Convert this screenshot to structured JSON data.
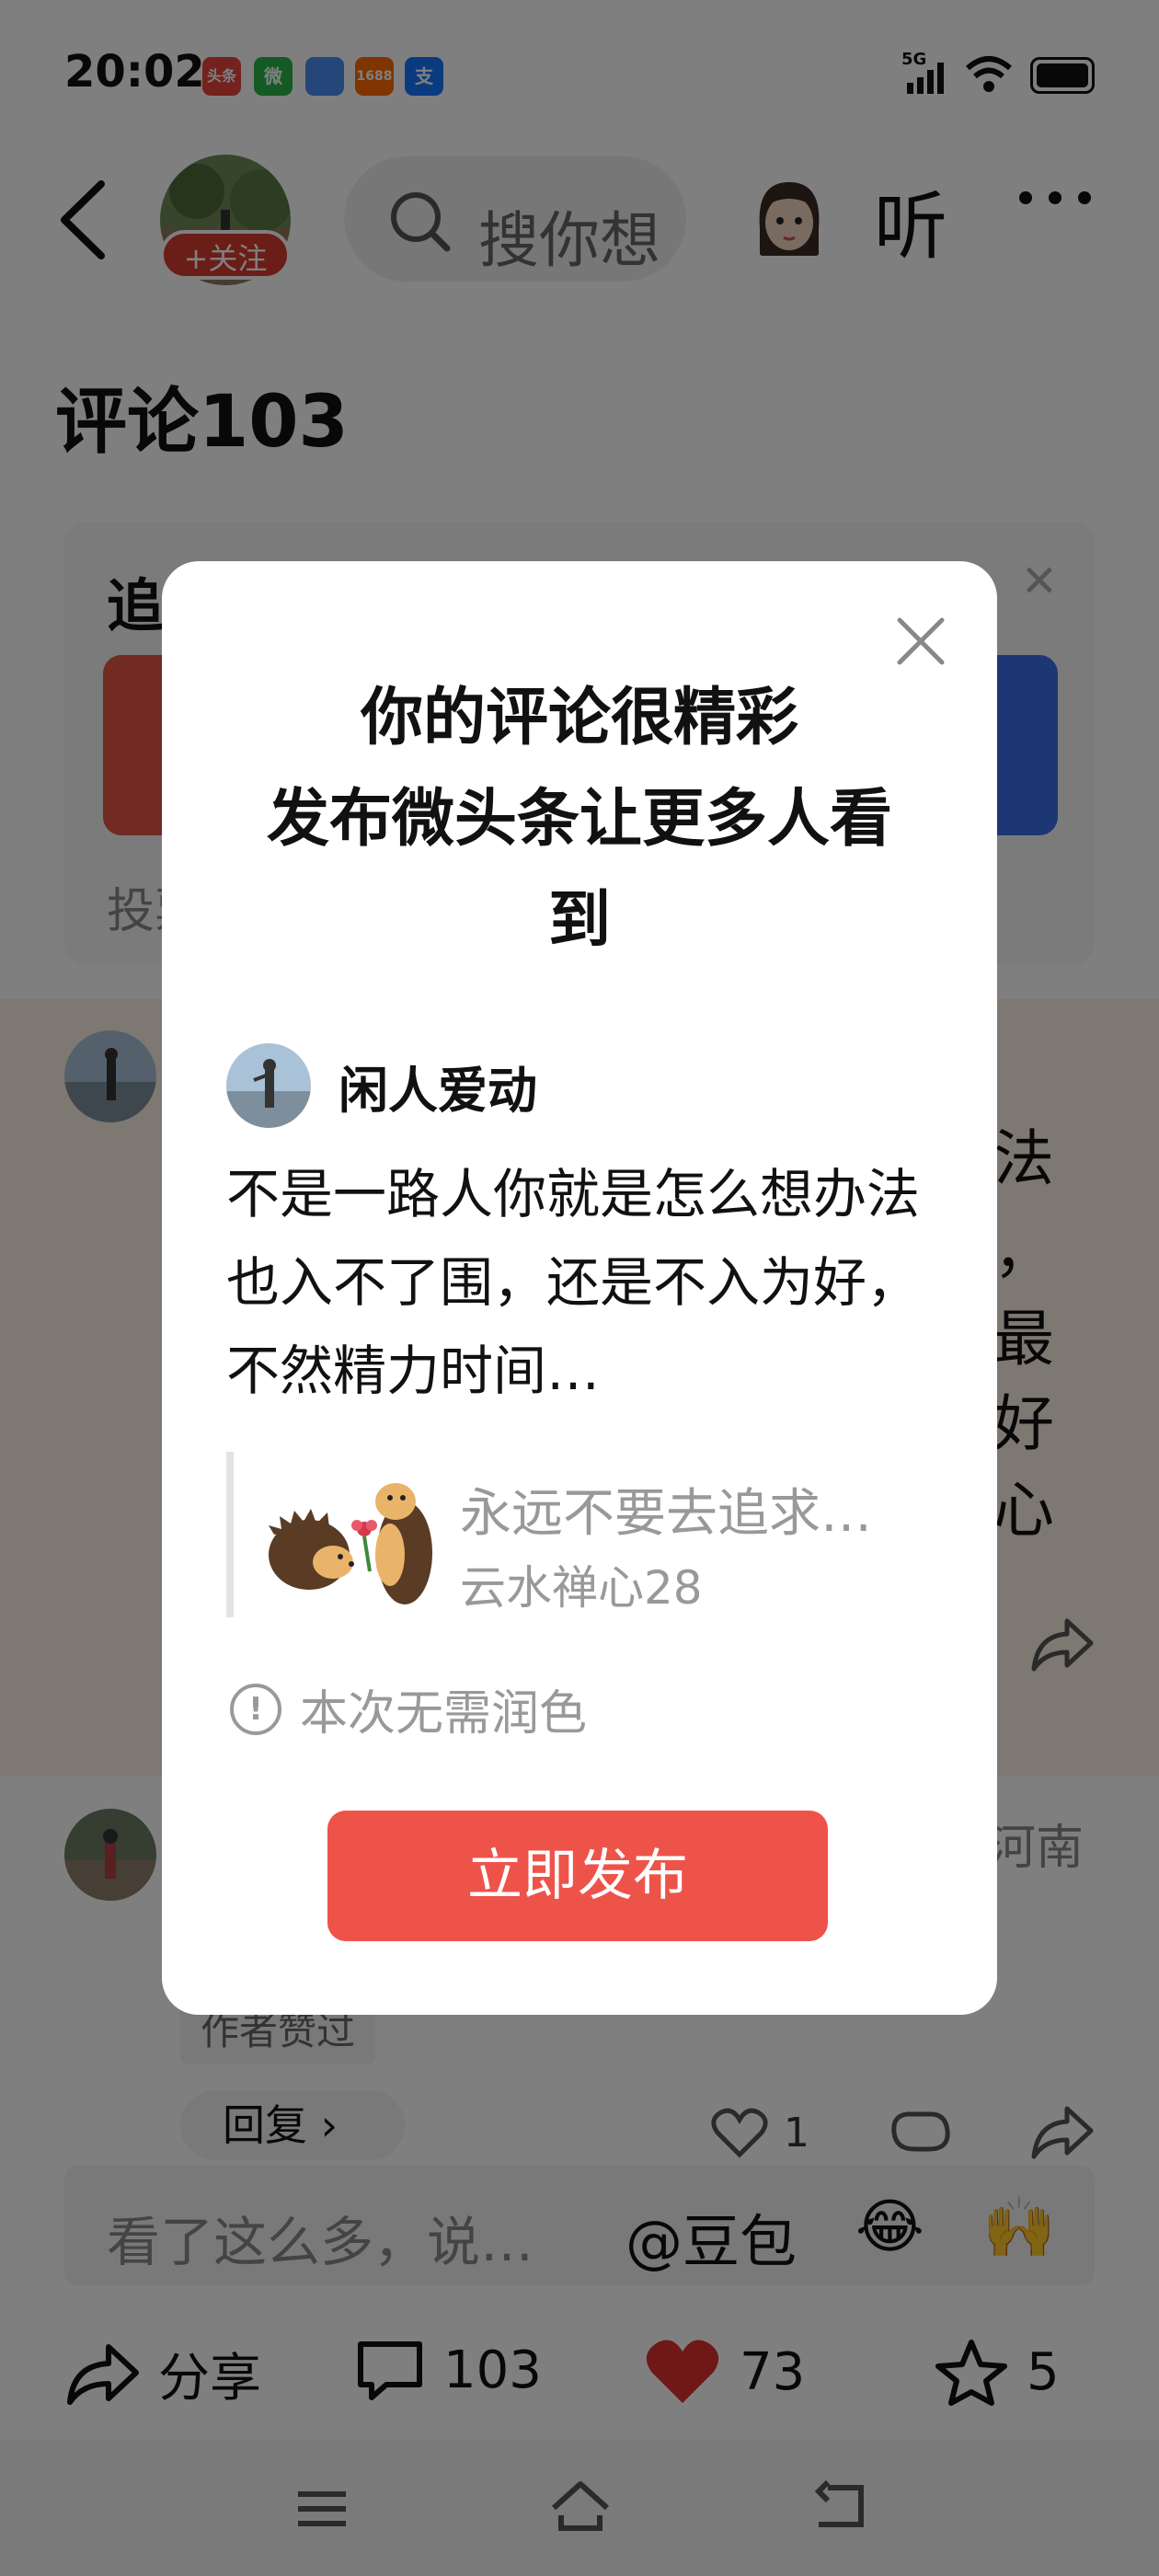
{
  "status_bar": {
    "time": "20:02",
    "network": "5G",
    "notification_apps": [
      {
        "label": "头条",
        "color": "#e8453c"
      },
      {
        "label": "微",
        "color": "#2bb44a"
      },
      {
        "label": "",
        "color": "#4a8df0"
      },
      {
        "label": "1688",
        "color": "#ff6a00"
      },
      {
        "label": "支",
        "color": "#1677ff"
      }
    ]
  },
  "header": {
    "follow_label": "+关注",
    "search_placeholder": "搜你想",
    "listen_label": "听"
  },
  "comments_title": "评论103",
  "background_card": {
    "title": "追",
    "footer": "投票"
  },
  "highlight_comment": {
    "side_text": [
      "法",
      "，",
      "最",
      "好",
      "心"
    ]
  },
  "second_comment": {
    "location": "河南",
    "author_liked_label": "作者赞过",
    "reply_label": "回复 ›",
    "like_count": "1"
  },
  "comment_input": {
    "placeholder": "看了这么多，说…",
    "at_label": "@豆包"
  },
  "action_bar": {
    "share_label": "分享",
    "comment_count": "103",
    "like_count": "73",
    "favorite_count": "5"
  },
  "modal": {
    "title_line1": "你的评论很精彩",
    "title_line2": "发布微头条让更多人看",
    "title_line3": "到",
    "user_name": "闲人爱动",
    "body_text": "不是一路人你就是怎么想办法也入不了围，还是不入为好，不然精力时间…",
    "quote_title": "永远不要去追求…",
    "quote_author": "云水禅心28",
    "hint_text": "本次无需润色",
    "publish_label": "立即发布"
  },
  "colors": {
    "accent_red": "#ee534a",
    "follow_red": "#d63b2f",
    "like_red": "#e02f2f"
  }
}
